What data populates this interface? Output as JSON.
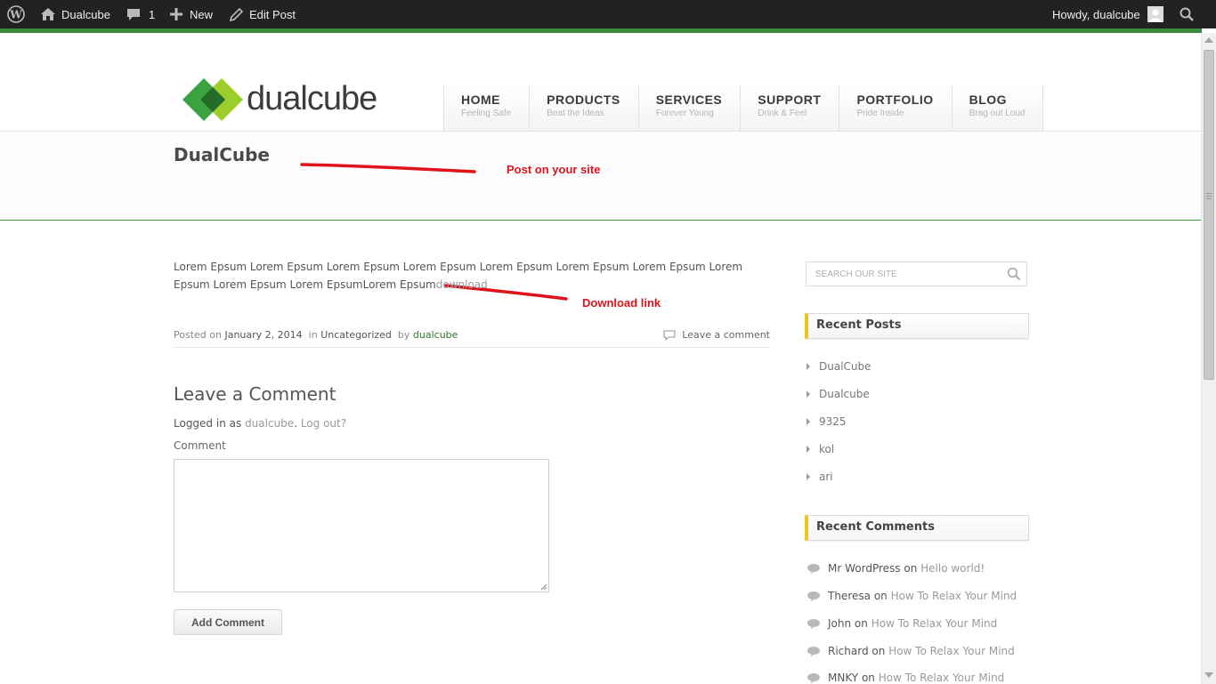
{
  "admin_bar": {
    "site_name": "Dualcube",
    "comments_count": "1",
    "new_label": "New",
    "edit_label": "Edit Post",
    "howdy": "Howdy, dualcube"
  },
  "site": {
    "logo_text": "dualcube",
    "nav": [
      {
        "title": "HOME",
        "sub": "Feeling Safe"
      },
      {
        "title": "PRODUCTS",
        "sub": "Beat the Ideas"
      },
      {
        "title": "SERVICES",
        "sub": "Forever Young"
      },
      {
        "title": "SUPPORT",
        "sub": "Drink & Feel"
      },
      {
        "title": "PORTFOLIO",
        "sub": "Pride Inside"
      },
      {
        "title": "BLOG",
        "sub": "Brag out Loud"
      }
    ]
  },
  "annotations": {
    "post_note": "Post on your site",
    "download_note": "Download link"
  },
  "post": {
    "title": "DualCube",
    "body": "Lorem Epsum Lorem Epsum Lorem Epsum Lorem Epsum Lorem Epsum Lorem Epsum Lorem Epsum Lorem Epsum Lorem Epsum Lorem EpsumLorem Epsum",
    "download_link": "download",
    "meta": {
      "posted_on": "Posted on",
      "date": "January 2, 2014",
      "in": "in",
      "category": "Uncategorized",
      "by": "by",
      "author": "dualcube",
      "leave_comment": "Leave a comment"
    }
  },
  "comment_form": {
    "heading": "Leave a Comment",
    "logged_in_prefix": "Logged in as",
    "user": "dualcube",
    "logout": "Log out?",
    "comment_label": "Comment",
    "submit": "Add Comment"
  },
  "sidebar": {
    "search_placeholder": "SEARCH OUR SITE",
    "recent_posts_title": "Recent Posts",
    "recent_posts": [
      "DualCube",
      "Dualcube",
      "9325",
      "kol",
      "ari"
    ],
    "recent_comments_title": "Recent Comments",
    "recent_comments": [
      {
        "author": "Mr WordPress",
        "on": "on",
        "post": "Hello world!"
      },
      {
        "author": "Theresa",
        "on": "on",
        "post": "How To Relax Your Mind"
      },
      {
        "author": "John",
        "on": "on",
        "post": "How To Relax Your Mind"
      },
      {
        "author": "Richard",
        "on": "on",
        "post": "How To Relax Your Mind"
      },
      {
        "author": "MNKY",
        "on": "on",
        "post": "How To Relax Your Mind"
      }
    ]
  },
  "colors": {
    "admin_bar_bg": "#222222",
    "accent_green": "#3b8a3a",
    "widget_accent": "#f0c419",
    "annotation_red": "#e0121a"
  }
}
